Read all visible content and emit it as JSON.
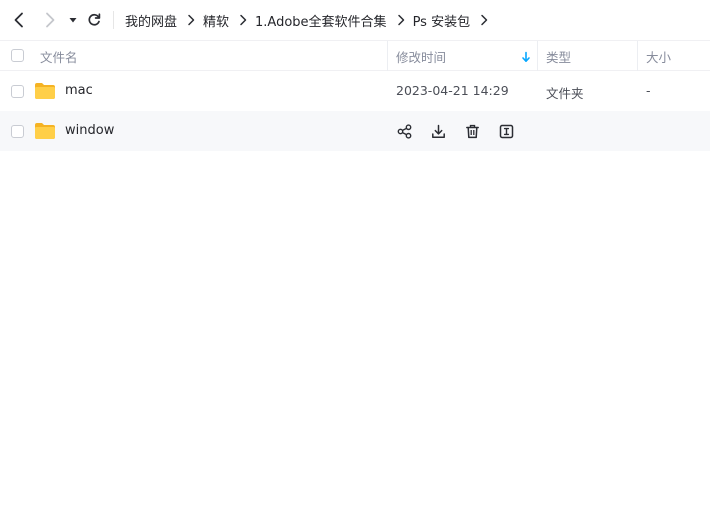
{
  "toolbar": {
    "back_icon": "chevron-left-icon",
    "forward_icon": "chevron-right-icon",
    "history_icon": "caret-down-icon",
    "refresh_icon": "refresh-icon"
  },
  "breadcrumb": [
    "我的网盘",
    "精软",
    "1.Adobe全套软件合集",
    "Ps 安装包"
  ],
  "columns": {
    "name": "文件名",
    "modified": "修改时间",
    "type": "类型",
    "size": "大小",
    "sort_icon": "arrow-down-icon",
    "sort_color": "#06a7ff"
  },
  "rows": [
    {
      "name": "mac",
      "modified": "2023-04-21 14:29",
      "type": "文件夹",
      "size": "-"
    },
    {
      "name": "window",
      "modified": "",
      "type": "",
      "size": "",
      "actions": [
        "share-icon",
        "download-icon",
        "delete-icon",
        "rename-icon"
      ]
    }
  ],
  "colors": {
    "folder": "#ffc93c",
    "folder_back": "#f5b324",
    "hover_row": "#f7f8fa"
  }
}
